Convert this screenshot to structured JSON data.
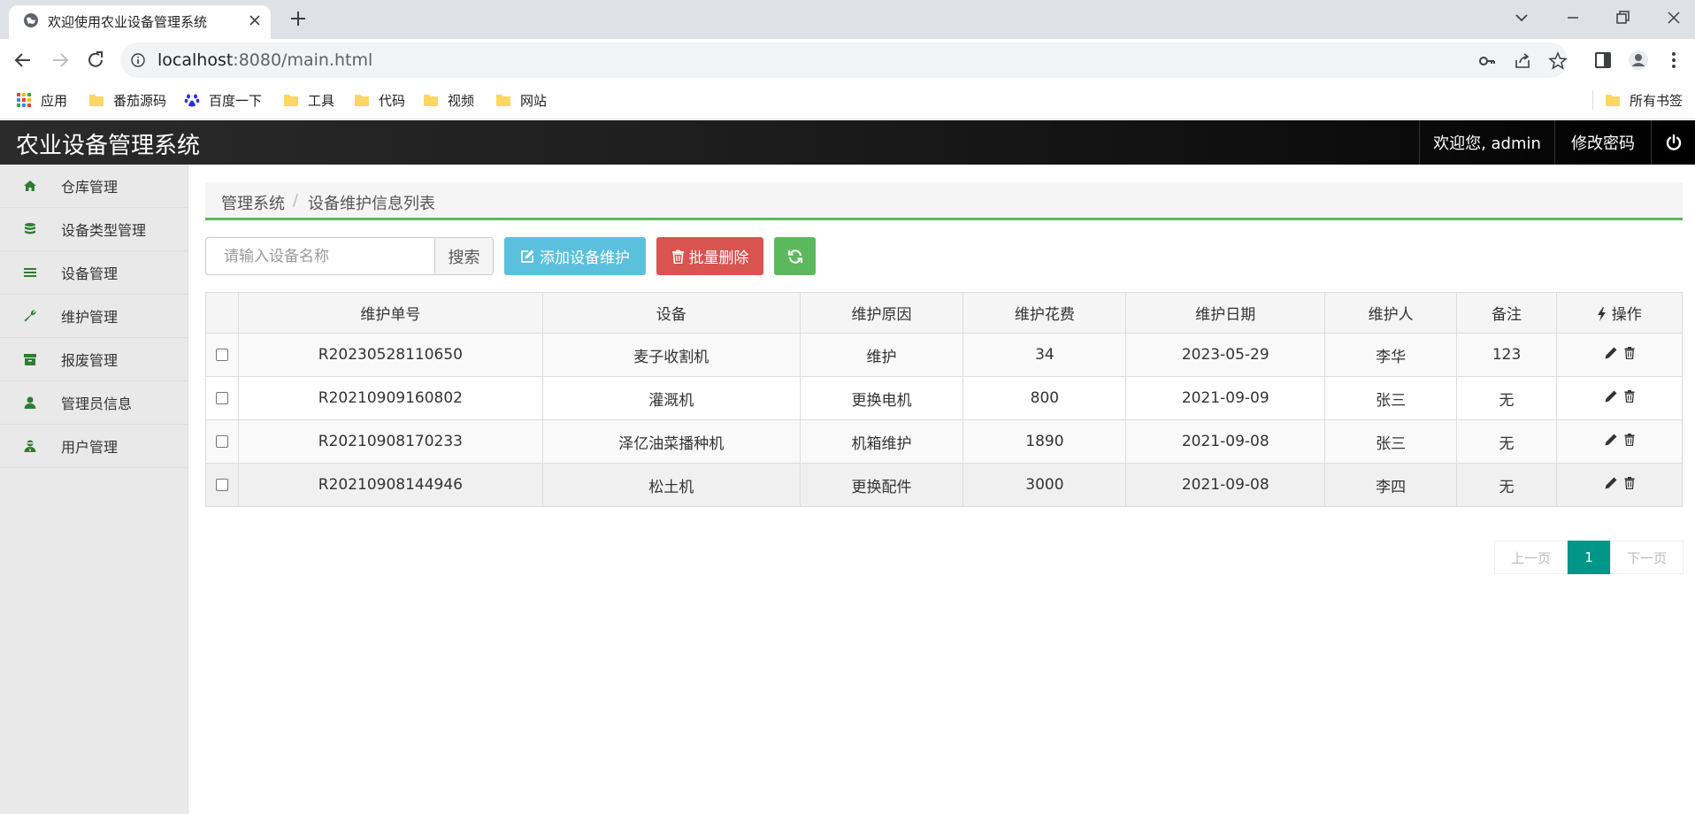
{
  "browser": {
    "tab_title": "欢迎使用农业设备管理系统",
    "url_host": "localhost",
    "url_rest": ":8080/main.html",
    "bookmarks": [
      "应用",
      "番茄源码",
      "百度一下",
      "工具",
      "代码",
      "视频",
      "网站"
    ],
    "all_bookmarks": "所有书签"
  },
  "header": {
    "title": "农业设备管理系统",
    "welcome": "欢迎您, admin",
    "change_password": "修改密码"
  },
  "sidebar": {
    "items": [
      {
        "label": "仓库管理",
        "icon": "home-icon"
      },
      {
        "label": "设备类型管理",
        "icon": "database-icon"
      },
      {
        "label": "设备管理",
        "icon": "list-icon"
      },
      {
        "label": "维护管理",
        "icon": "wrench-icon"
      },
      {
        "label": "报废管理",
        "icon": "archive-icon"
      },
      {
        "label": "管理员信息",
        "icon": "user-icon"
      },
      {
        "label": "用户管理",
        "icon": "user-secret-icon"
      }
    ]
  },
  "breadcrumb": {
    "root": "管理系统",
    "separator": "/",
    "current": "设备维护信息列表"
  },
  "toolbar": {
    "search_placeholder": "请输入设备名称",
    "search_label": "搜索",
    "add_label": "添加设备维护",
    "batch_delete_label": "批量删除"
  },
  "table": {
    "columns": [
      "维护单号",
      "设备",
      "维护原因",
      "维护花费",
      "维护日期",
      "维护人",
      "备注",
      "操作"
    ],
    "rows": [
      [
        "R20230528110650",
        "麦子收割机",
        "维护",
        "34",
        "2023-05-29",
        "李华",
        "123"
      ],
      [
        "R20210909160802",
        "灌溉机",
        "更换电机",
        "800",
        "2021-09-09",
        "张三",
        "无"
      ],
      [
        "R20210908170233",
        "泽亿油菜播种机",
        "机箱维护",
        "1890",
        "2021-09-08",
        "张三",
        "无"
      ],
      [
        "R20210908144946",
        "松土机",
        "更换配件",
        "3000",
        "2021-09-08",
        "李四",
        "无"
      ]
    ]
  },
  "pagination": {
    "prev": "上一页",
    "current": "1",
    "next": "下一页"
  },
  "colors": {
    "header_bg": "#1a1a1a",
    "accent_green": "#5cb85c",
    "info": "#5bc0de",
    "danger": "#d9534f",
    "page_active": "#009688",
    "sidebar_icon": "#2e7d32"
  }
}
